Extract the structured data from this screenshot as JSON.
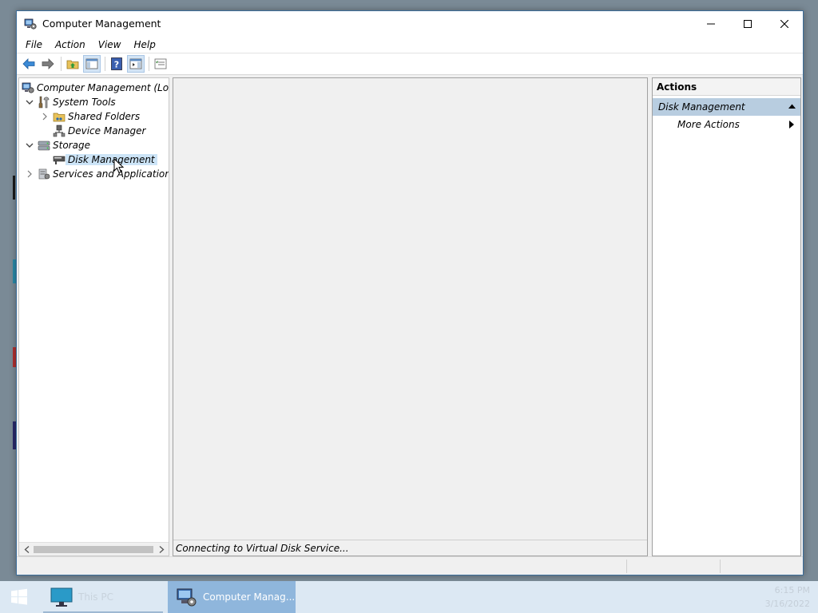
{
  "window": {
    "title": "Computer Management"
  },
  "menu": [
    "File",
    "Action",
    "View",
    "Help"
  ],
  "toolbar": {
    "buttons": [
      "back-icon",
      "forward-icon",
      "up-folder-icon",
      "show-hide-console-tree-icon",
      "help-icon",
      "show-hide-action-pane-icon",
      "properties-icon"
    ]
  },
  "tree": {
    "root": "Computer Management (Local)",
    "system_tools": "System Tools",
    "shared_folders": "Shared Folders",
    "device_manager": "Device Manager",
    "storage": "Storage",
    "disk_management": "Disk Management",
    "services_apps": "Services and Applications"
  },
  "center": {
    "status": "Connecting to Virtual Disk Service..."
  },
  "actions": {
    "header": "Actions",
    "section": "Disk Management",
    "more_actions": "More Actions"
  },
  "taskbar": {
    "items": [
      "This PC",
      "Computer Manag..."
    ],
    "time": "6:15 PM",
    "date": "3/16/2022"
  },
  "colors": {
    "selection": "#cce4f7",
    "actions_section": "#b8cde0",
    "taskbar": "#dce8f3",
    "taskbar_active": "#8fb6dc"
  }
}
